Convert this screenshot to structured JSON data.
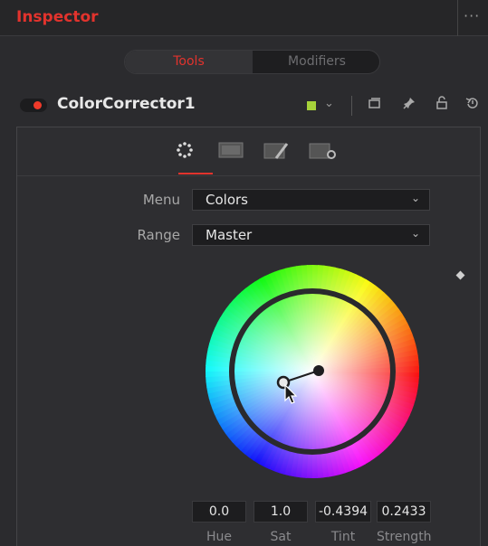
{
  "window": {
    "title": "Inspector",
    "more_glyph": "···"
  },
  "tabs": [
    {
      "label": "Tools",
      "active": true
    },
    {
      "label": "Modifiers",
      "active": false
    }
  ],
  "node": {
    "name": "ColorCorrector1",
    "enabled": true,
    "color_swatch": "#a6d23a",
    "icons": [
      "versions-icon",
      "pin-icon",
      "lock-icon",
      "reset-icon"
    ]
  },
  "panel_tabs": [
    {
      "icon": "color-dots-icon",
      "active": true
    },
    {
      "icon": "levels-image-icon",
      "active": false
    },
    {
      "icon": "options-pencil-icon",
      "active": false
    },
    {
      "icon": "settings-gear-icon",
      "active": false
    }
  ],
  "menu": {
    "label": "Menu",
    "value": "Colors"
  },
  "range": {
    "label": "Range",
    "value": "Master"
  },
  "color_wheel": {
    "hue": "0.0",
    "sat": "1.0",
    "tint": "-0.4394",
    "strength": "0.2433"
  },
  "field_labels": {
    "hue": "Hue",
    "sat": "Sat",
    "tint": "Tint",
    "strength": "Strength"
  },
  "accent_color": "#e2332d"
}
